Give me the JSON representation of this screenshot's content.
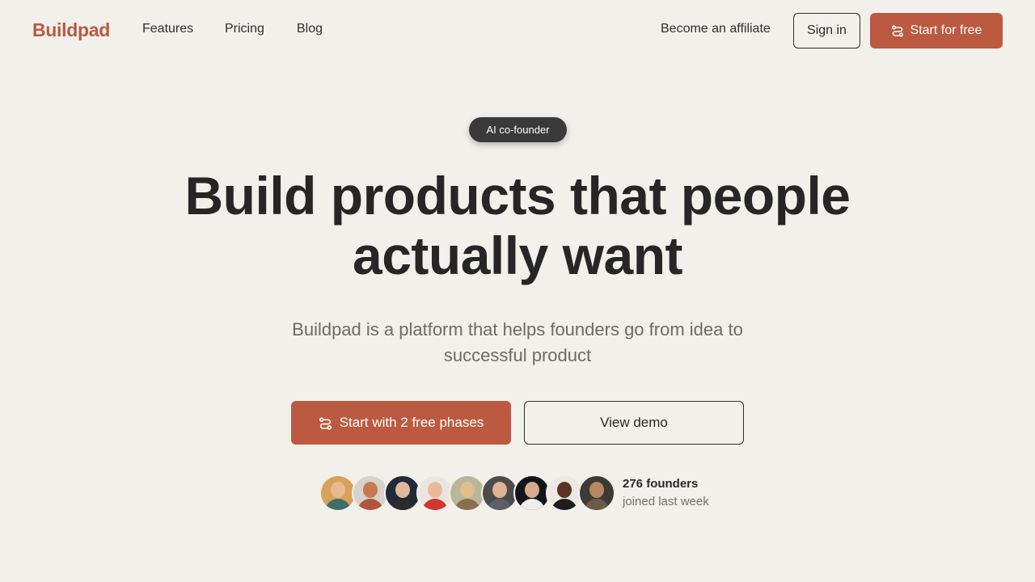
{
  "header": {
    "logo": "Buildpad",
    "nav": [
      {
        "label": "Features"
      },
      {
        "label": "Pricing"
      },
      {
        "label": "Blog"
      }
    ],
    "affiliate": "Become an affiliate",
    "sign_in": "Sign in",
    "start_free": "Start for free",
    "start_icon": "route-icon"
  },
  "hero": {
    "badge": "AI co-founder",
    "headline_line1": "Build products that people",
    "headline_line2": "actually want",
    "subtitle_line1": "Buildpad is a platform that helps founders go from idea to",
    "subtitle_line2": "successful product",
    "primary_cta": "Start with 2 free phases",
    "secondary_cta": "View demo"
  },
  "social_proof": {
    "count": "276 founders",
    "text": "joined last week",
    "avatar_count": 9
  },
  "colors": {
    "background": "#f2f0eb",
    "accent": "#bb5a41",
    "text": "#262626",
    "muted": "#6e6b66"
  }
}
